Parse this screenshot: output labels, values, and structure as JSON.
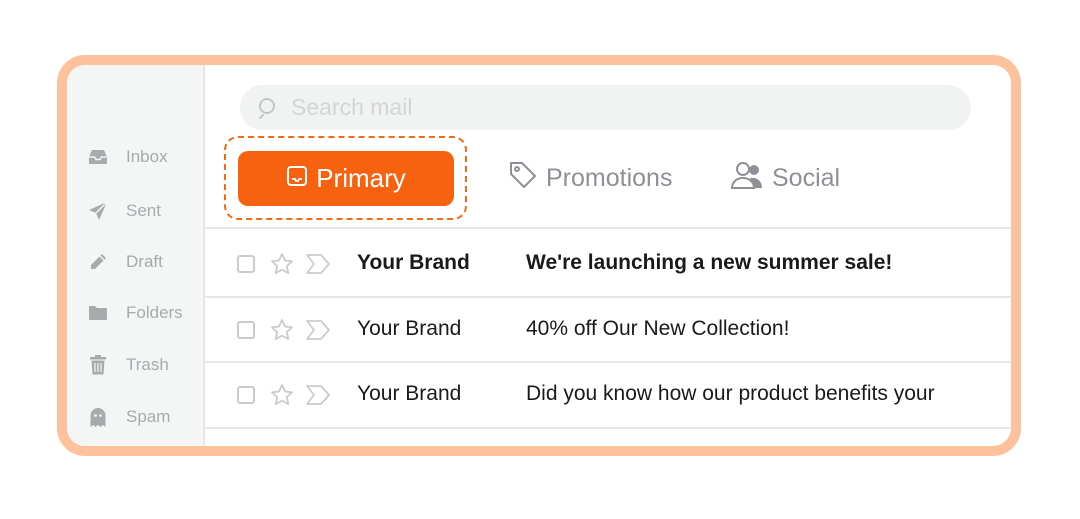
{
  "sidebar": {
    "items": [
      {
        "label": "Inbox",
        "icon": "inbox-icon"
      },
      {
        "label": "Sent",
        "icon": "paper-plane-icon"
      },
      {
        "label": "Draft",
        "icon": "pencil-icon"
      },
      {
        "label": "Folders",
        "icon": "folder-icon"
      },
      {
        "label": "Trash",
        "icon": "trash-icon"
      },
      {
        "label": "Spam",
        "icon": "ghost-icon"
      }
    ]
  },
  "search": {
    "placeholder": "Search mail",
    "value": ""
  },
  "tabs": [
    {
      "label": "Primary",
      "icon": "inbox-tray-icon",
      "selected": true
    },
    {
      "label": "Promotions",
      "icon": "tag-icon",
      "selected": false
    },
    {
      "label": "Social",
      "icon": "people-icon",
      "selected": false
    }
  ],
  "emails": [
    {
      "sender": "Your Brand",
      "subject": "We're launching a new summer sale!",
      "unread": true
    },
    {
      "sender": "Your Brand",
      "subject": "40% off Our New Collection!",
      "unread": false
    },
    {
      "sender": "Your Brand",
      "subject": "Did you know how our product benefits your",
      "unread": false
    }
  ],
  "colors": {
    "frame_border": "#FDC29B",
    "accent": "#F6620F",
    "sidebar_bg": "#F4F5F5",
    "muted_text": "#A7ABAE"
  }
}
